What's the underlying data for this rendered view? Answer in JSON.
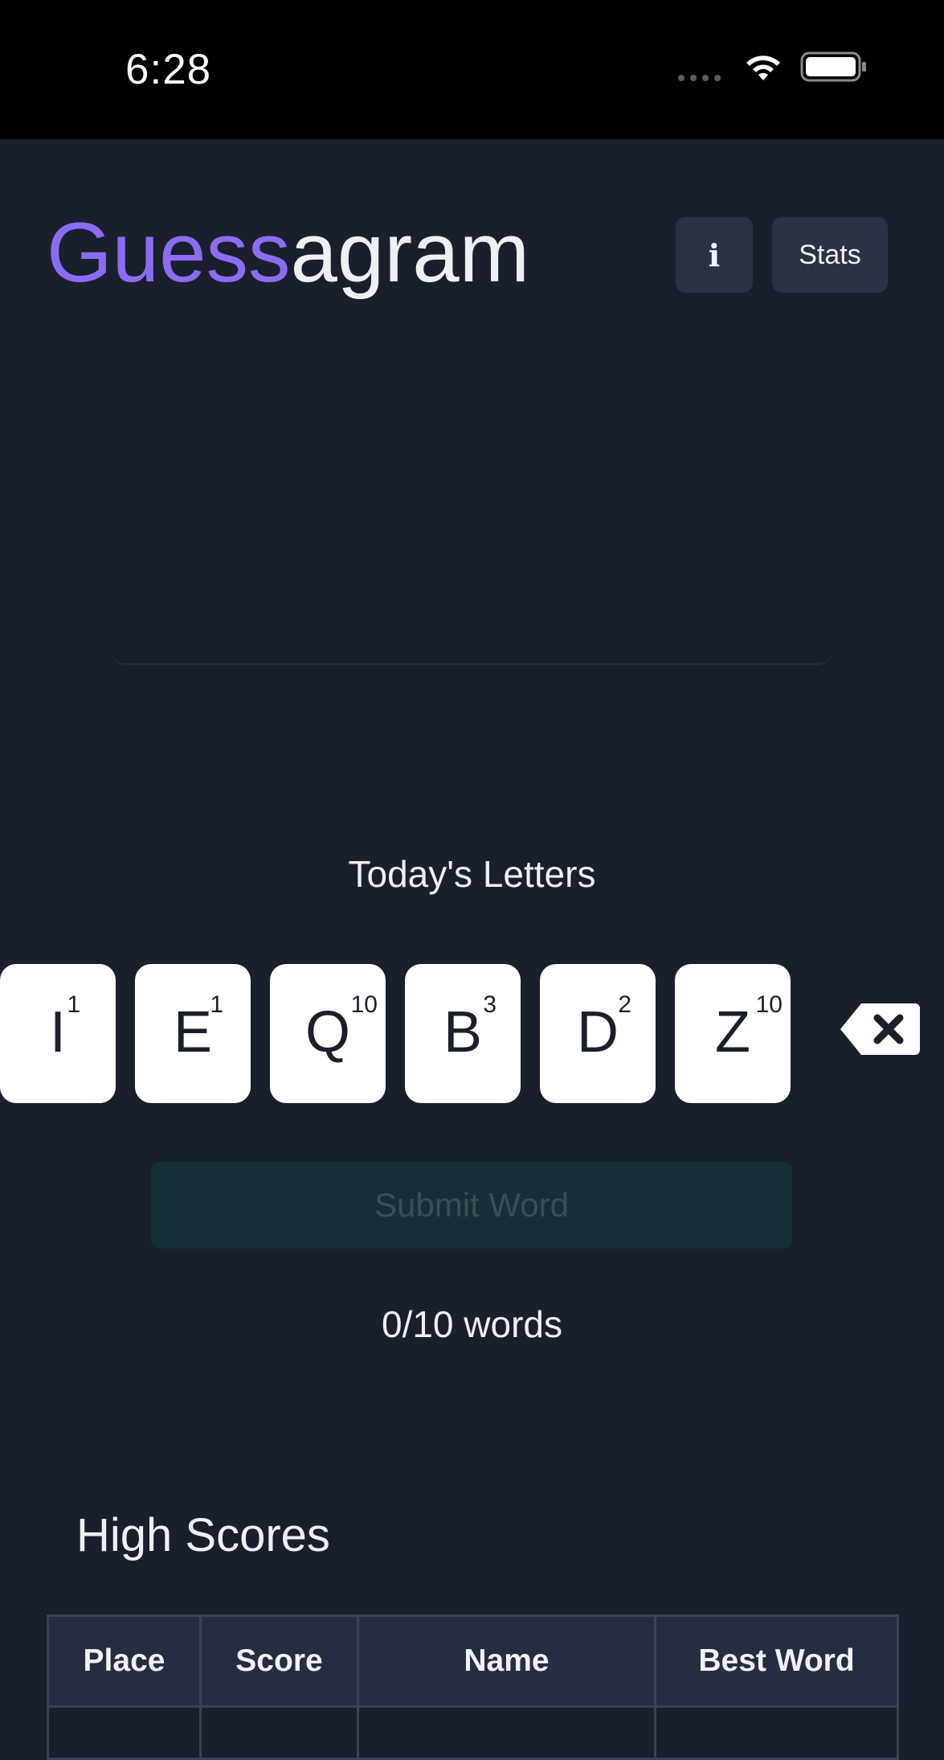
{
  "status_bar": {
    "time": "6:28"
  },
  "header": {
    "title_accent": "Guess",
    "title_rest": "agram",
    "info_label": "i",
    "stats_label": "Stats"
  },
  "letters": {
    "heading": "Today's Letters",
    "tiles": [
      {
        "letter": "I",
        "score": "1"
      },
      {
        "letter": "E",
        "score": "1"
      },
      {
        "letter": "Q",
        "score": "10"
      },
      {
        "letter": "B",
        "score": "3"
      },
      {
        "letter": "D",
        "score": "2"
      },
      {
        "letter": "Z",
        "score": "10"
      }
    ]
  },
  "submit": {
    "label": "Submit Word"
  },
  "progress": {
    "text": "0/10 words"
  },
  "high_scores": {
    "heading": "High Scores",
    "columns": [
      "Place",
      "Score",
      "Name",
      "Best Word"
    ]
  },
  "colors": {
    "background": "#1a1f2c",
    "accent": "#8b6cf2",
    "submit_disabled_bg": "#162e35"
  }
}
